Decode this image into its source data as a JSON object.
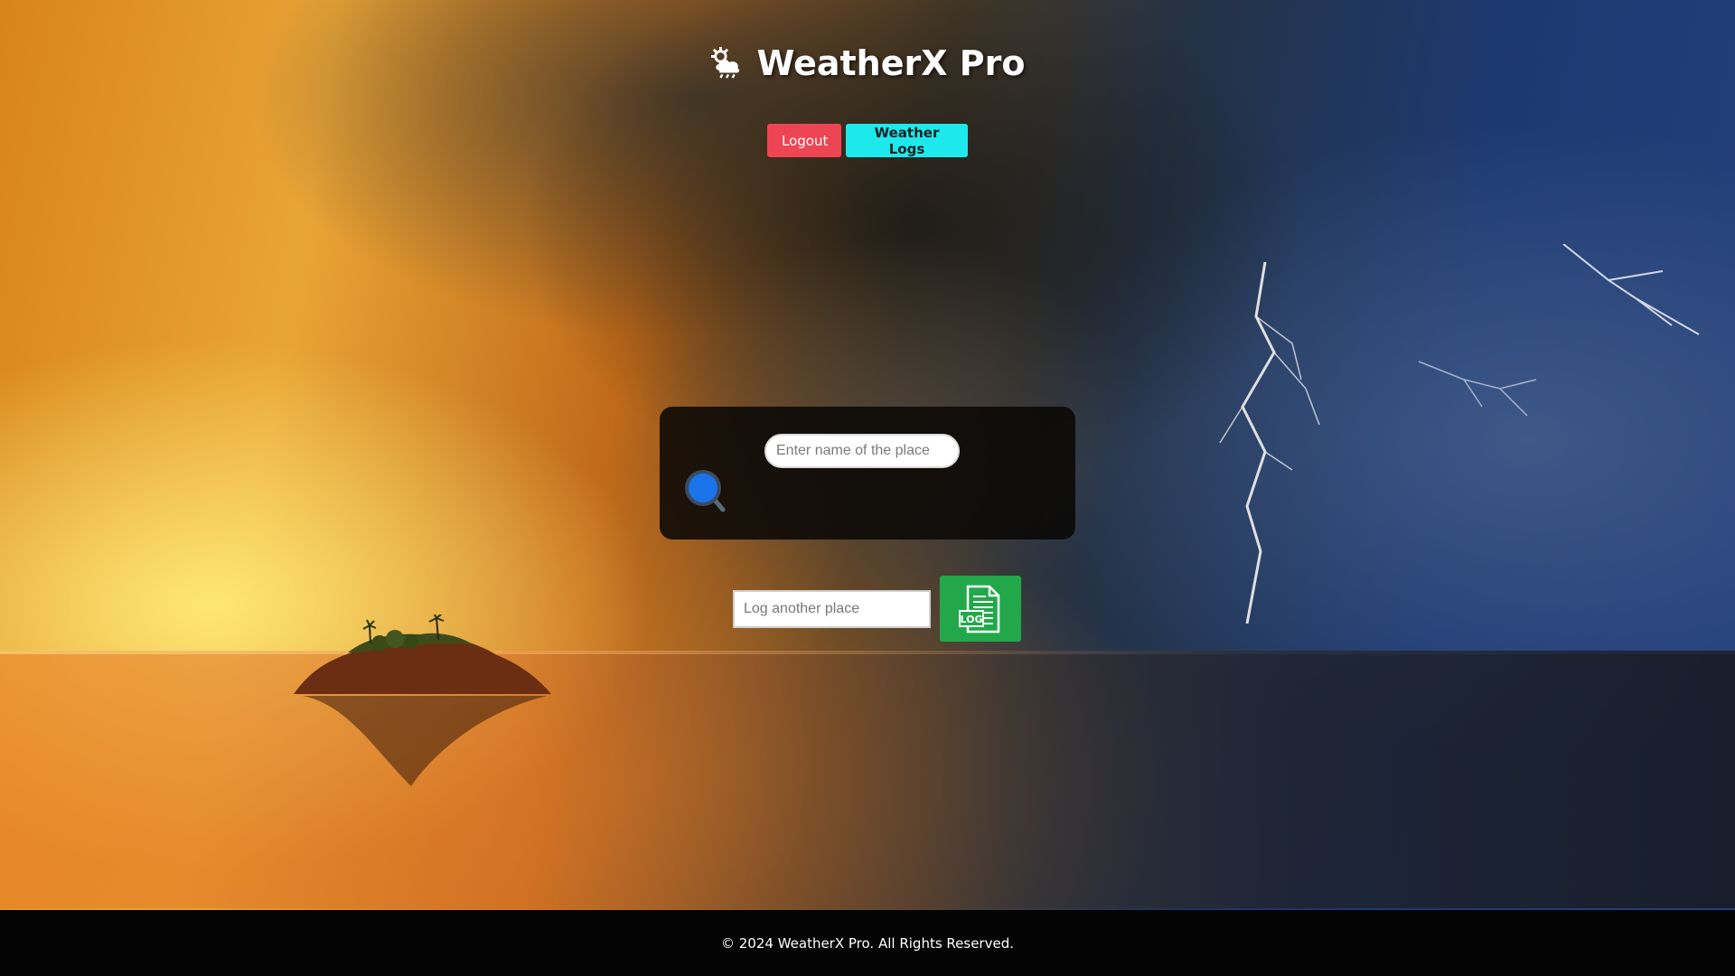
{
  "app": {
    "title": "WeatherX Pro",
    "logo_icon": "cloud-sun-rain-icon"
  },
  "nav": {
    "logout_label": "Logout",
    "weather_logs_label": "Weather Logs"
  },
  "search": {
    "placeholder": "Enter name of the place",
    "value": "",
    "button_icon": "magnifier-icon"
  },
  "log": {
    "placeholder": "Log another place",
    "value": "",
    "button_icon": "log-document-icon",
    "button_icon_text": "LOG"
  },
  "footer": {
    "text": "© 2024 WeatherX Pro. All Rights Reserved."
  },
  "colors": {
    "logout_button": "#ee4554",
    "weather_logs_button": "#1de9ec",
    "log_button": "#22a84a",
    "search_icon": "#1a73e8",
    "footer_bg": "#050404"
  }
}
